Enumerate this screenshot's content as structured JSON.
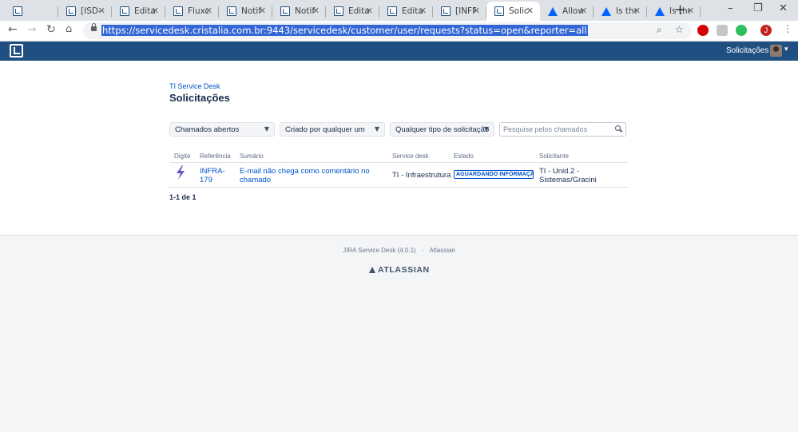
{
  "browser": {
    "tabs": [
      {
        "title": "",
        "favicon": "jira-icon",
        "active": false
      },
      {
        "title": "[ISD-",
        "favicon": "jira-icon",
        "active": false
      },
      {
        "title": "Edita",
        "favicon": "jira-icon",
        "active": false
      },
      {
        "title": "Fluxo",
        "favicon": "jira-icon",
        "active": false
      },
      {
        "title": "Notif",
        "favicon": "jira-icon",
        "active": false
      },
      {
        "title": "Notif",
        "favicon": "jira-icon",
        "active": false
      },
      {
        "title": "Edita",
        "favicon": "jira-icon",
        "active": false
      },
      {
        "title": "Edita",
        "favicon": "jira-icon",
        "active": false
      },
      {
        "title": "[INFR",
        "favicon": "jira-icon",
        "active": false
      },
      {
        "title": "Solici",
        "favicon": "jira-icon",
        "active": true
      },
      {
        "title": "Allow",
        "favicon": "atlassian-icon",
        "active": false
      },
      {
        "title": "Is the",
        "favicon": "atlassian-icon",
        "active": false
      },
      {
        "title": "Is the",
        "favicon": "atlassian-icon",
        "active": false
      }
    ],
    "url": "https://servicedesk.cristalia.com.br:9443/servicedesk/customer/user/requests?status=open&reporter=all",
    "profile_initial": "J"
  },
  "header": {
    "requests_link": "Solicitações"
  },
  "page": {
    "breadcrumb": "TI Service Desk",
    "title": "Solicitações"
  },
  "filters": {
    "status": "Chamados abertos",
    "creator": "Criado por qualquer um",
    "type": "Qualquer tipo de solicitação",
    "search_placeholder": "Pesquise pelos chamados"
  },
  "table": {
    "columns": [
      "Digite",
      "Referência",
      "Sumário",
      "Service desk",
      "Estado",
      "Solicitante"
    ],
    "rows": [
      {
        "type_icon": "lightning-bolt-icon",
        "reference_1": "INFRA-",
        "reference_2": "179",
        "summary_1": "E-mail não chega como comentário no",
        "summary_2": "chamado",
        "service_desk": "TI - Infraestrutura",
        "status": "AGUARDANDO INFORMAÇÃO",
        "reporter_1": "TI - Unid.2 -",
        "reporter_2": "Sistemas/Gracini"
      }
    ],
    "pagination": "1-1 de 1"
  },
  "footer": {
    "product": "JIRA Service Desk (4.0.1)",
    "separator": "·",
    "vendor": "Atlassian",
    "logo_text": "ATLASSIAN"
  },
  "colors": {
    "header_bg": "#205081",
    "link": "#0052cc",
    "url_highlight": "#3367d6"
  }
}
